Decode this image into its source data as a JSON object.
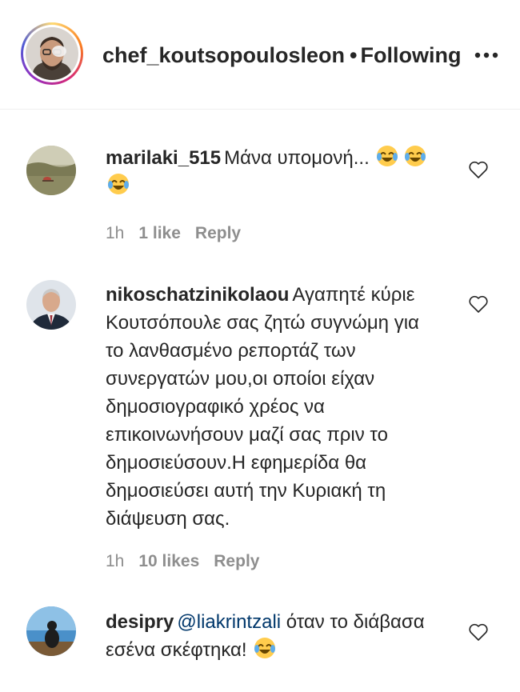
{
  "post": {
    "author": "chef_koutsopoulosleon",
    "separator": "•",
    "follow_state": "Following"
  },
  "comments": [
    {
      "username": "marilaki_515",
      "text": "Μάνα υπομονή...",
      "time": "1h",
      "likes": "1 like",
      "reply_label": "Reply"
    },
    {
      "username": "nikoschatzinikolaou",
      "text": "Αγαπητέ κύριε Κουτσόπουλε σας ζητώ συγνώμη για το λανθασμένο ρεπορτάζ των συνεργατών μου,οι οποίοι είχαν δημοσιογραφικό χρέος να επικοινωνήσουν μαζί σας πριν το δημοσιεύσουν.Η εφημερίδα θα δημοσιεύσει αυτή την Κυριακή τη διάψευση σας.",
      "time": "1h",
      "likes": "10 likes",
      "reply_label": "Reply"
    },
    {
      "username": "desipry",
      "mention": "@liakrintzali",
      "text": "όταν το διάβασα εσένα σκέφτηκα!"
    }
  ],
  "icons": {
    "more": "more-options-icon",
    "heart": "heart-outline-icon",
    "emoji": "face-with-tears-of-joy-emoji"
  },
  "colors": {
    "text": "#262626",
    "meta": "#8e8e8e",
    "mention": "#00376b",
    "divider": "#efefef"
  }
}
